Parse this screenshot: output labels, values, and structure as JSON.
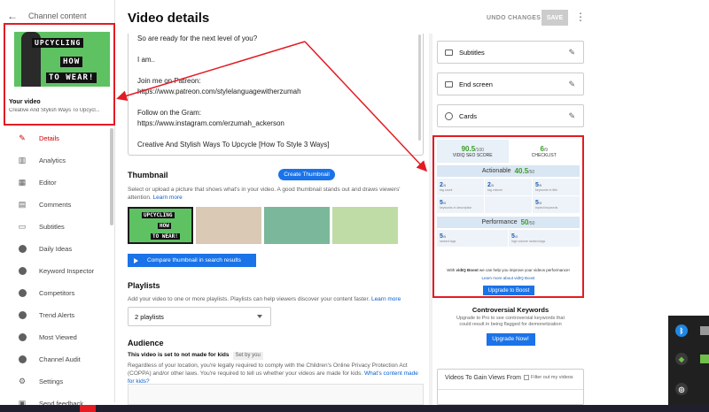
{
  "sidebar": {
    "back_label": "←",
    "header": "Channel content",
    "thumb_words": [
      "UPCYCLING",
      "HOW",
      "TO WEAR!"
    ],
    "your_video": "Your video",
    "video_title": "Creative And Stylish Ways To Upcycl...",
    "items": [
      {
        "label": "Details",
        "icon": "pencil-icon",
        "glyph": "✎"
      },
      {
        "label": "Analytics",
        "icon": "analytics-icon",
        "glyph": "▥"
      },
      {
        "label": "Editor",
        "icon": "editor-icon",
        "glyph": "▦"
      },
      {
        "label": "Comments",
        "icon": "comments-icon",
        "glyph": "▤"
      },
      {
        "label": "Subtitles",
        "icon": "subtitles-icon",
        "glyph": "▭"
      },
      {
        "label": "Daily Ideas",
        "icon": "vidiq-icon",
        "glyph": ""
      },
      {
        "label": "Keyword Inspector",
        "icon": "vidiq-icon",
        "glyph": ""
      },
      {
        "label": "Competitors",
        "icon": "vidiq-icon",
        "glyph": ""
      },
      {
        "label": "Trend Alerts",
        "icon": "vidiq-icon",
        "glyph": ""
      },
      {
        "label": "Most Viewed",
        "icon": "vidiq-icon",
        "glyph": ""
      },
      {
        "label": "Channel Audit",
        "icon": "vidiq-icon",
        "glyph": ""
      },
      {
        "label": "Settings",
        "icon": "gear-icon",
        "glyph": "⚙"
      },
      {
        "label": "Send feedback",
        "icon": "feedback-icon",
        "glyph": "▣"
      }
    ]
  },
  "header": {
    "title": "Video details",
    "undo_label": "UNDO CHANGES",
    "save_label": "SAVE",
    "more": "⋮"
  },
  "description": {
    "lines": [
      "So are ready for the next level of you?",
      "",
      "I am..",
      "",
      "Join me on Patreon:",
      "https://www.patreon.com/stylelanguagewitherzumah",
      "",
      "Follow on the Gram:",
      "https://www.instagram.com/erzumah_ackerson",
      "",
      "Creative And Stylish Ways To Upcycle [How To Style 3 Ways]"
    ]
  },
  "thumbnail": {
    "title": "Thumbnail",
    "create_label": "Create Thumbnail",
    "help_text": "Select or upload a picture that shows what's in your video. A good thumbnail stands out and draws viewers' attention.",
    "learn_more": "Learn more",
    "mini_words": [
      "UPCYCLING",
      "HOW",
      "TO WEAR!"
    ],
    "compare_label": "Compare thumbnail in search results"
  },
  "playlists": {
    "title": "Playlists",
    "help_text": "Add your video to one or more playlists. Playlists can help viewers discover your content faster.",
    "learn_more": "Learn more",
    "selected": "2 playlists"
  },
  "audience": {
    "title": "Audience",
    "subtitle": "This video is set to not made for kids",
    "set_by": "Set by you",
    "text": "Regardless of your location, you're legally required to comply with the Children's Online Privacy Protection Act (COPPA) and/or other laws. You're required to tell us whether your videos are made for kids.",
    "link": "What's content made for kids?"
  },
  "right": {
    "cards": [
      {
        "label": "Subtitles",
        "icon": "subtitles-icon"
      },
      {
        "label": "End screen",
        "icon": "end-screen-icon"
      },
      {
        "label": "Cards",
        "icon": "info-icon"
      }
    ],
    "pencil": "✎",
    "vidiq": {
      "seo_score": "90.5",
      "seo_max": "/100",
      "seo_label": "VIDIQ SEO SCORE",
      "checklist_score": "6",
      "checklist_max": "/9",
      "checklist_label": "CHECKLIST",
      "actionable_label": "Actionable",
      "actionable_score": "40.5",
      "actionable_max": "/50",
      "actionable_cells": [
        {
          "v": "2",
          "max": "/5",
          "n": "tag count"
        },
        {
          "v": "2",
          "max": "/5",
          "n": "tag volume"
        },
        {
          "v": "5",
          "max": "/5",
          "n": "keywords in title"
        },
        {
          "v": "5",
          "max": "/5",
          "n": "keywords in description"
        },
        {
          "v": "",
          "max": "",
          "n": ""
        },
        {
          "v": "5",
          "max": "/5",
          "n": "tripled keywords"
        }
      ],
      "performance_label": "Performance",
      "performance_score": "50",
      "performance_max": "/50",
      "performance_cells": [
        {
          "v": "5",
          "max": "/5",
          "n": "ranked tags"
        },
        {
          "v": "5",
          "max": "/5",
          "n": "high volume ranked tags"
        }
      ],
      "boost_msg_pre": "With ",
      "boost_name": "vidIQ Boost",
      "boost_msg_post": " we can help you improve your videos performance!",
      "learn_more": "Learn more about vidIQ Boost",
      "upgrade_label": "Upgrade to Boost"
    },
    "controversial": {
      "title": "Controversial Keywords",
      "text": "Upgrade to Pro to see controversial keywords that could result in being flagged for demonetization",
      "button": "Upgrade Now!"
    },
    "vgvf": {
      "title": "Videos To Gain Views From",
      "filter": "Filter out my videos"
    }
  },
  "colors": {
    "accent": "#1a73e8",
    "annotation_red": "#e31b23",
    "active_nav": "#cc0000",
    "score_green": "#3a9d23"
  }
}
